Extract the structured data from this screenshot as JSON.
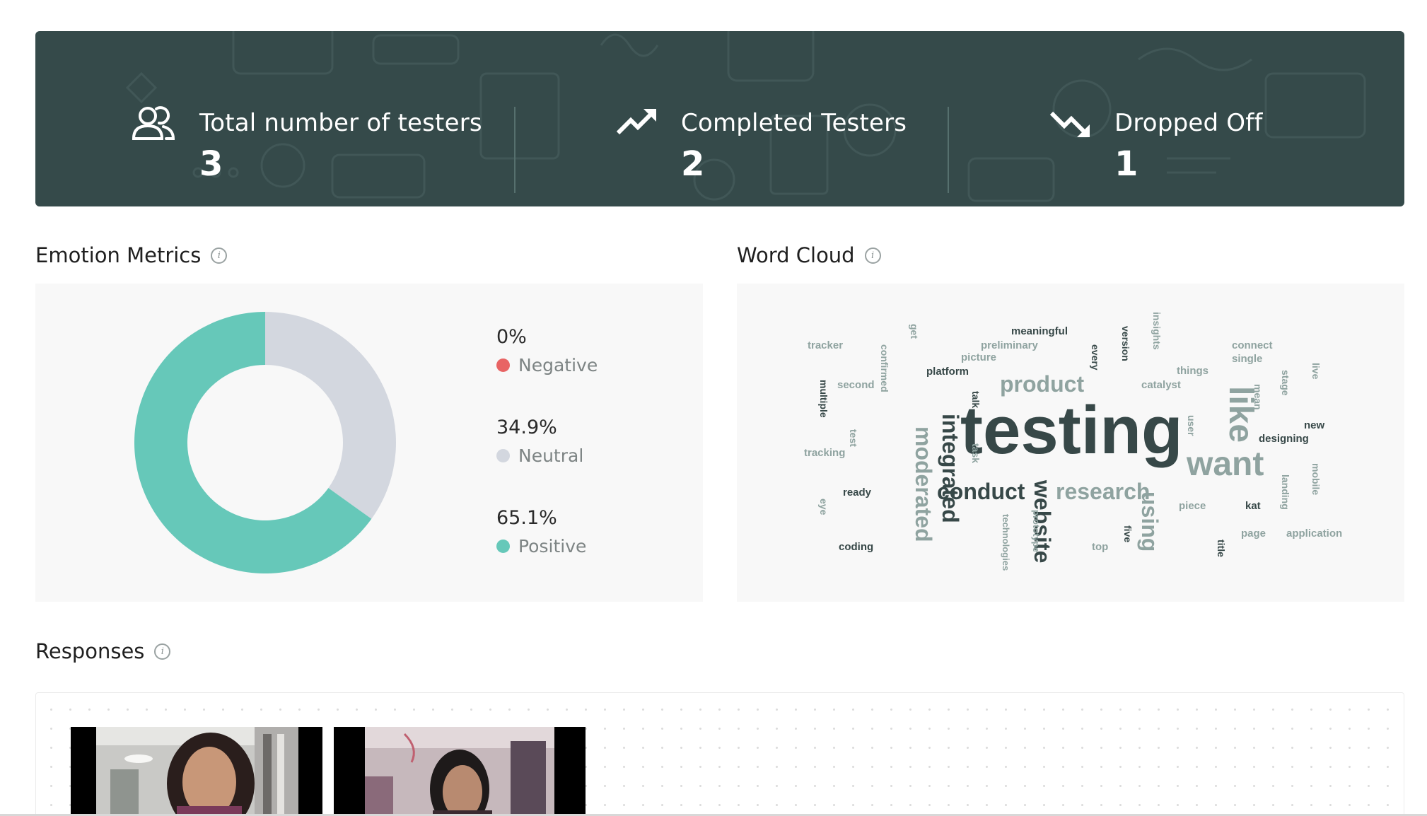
{
  "stats": [
    {
      "label": "Total number of testers",
      "value": "3",
      "icon": "users-icon"
    },
    {
      "label": "Completed Testers",
      "value": "2",
      "icon": "trend-up-icon"
    },
    {
      "label": "Dropped Off",
      "value": "1",
      "icon": "trend-down-icon"
    }
  ],
  "emotion": {
    "title": "Emotion Metrics",
    "items": [
      {
        "percent": "0%",
        "label": "Negative",
        "value": 0,
        "color": "#e86464"
      },
      {
        "percent": "34.9%",
        "label": "Neutral",
        "value": 34.9,
        "color": "#d3d7df"
      },
      {
        "percent": "65.1%",
        "label": "Positive",
        "value": 65.1,
        "color": "#66c8b9"
      }
    ]
  },
  "wordcloud": {
    "title": "Word Cloud",
    "words": [
      "testing",
      "like",
      "want",
      "product",
      "research",
      "conduct",
      "integrated",
      "moderated",
      "website",
      "using",
      "tracker",
      "get",
      "meaningful",
      "preliminary",
      "picture",
      "platform",
      "every",
      "version",
      "insights",
      "connect",
      "single",
      "things",
      "catalyst",
      "stage",
      "live",
      "mean",
      "confirmed",
      "multiple",
      "second",
      "talk",
      "test",
      "tracking",
      "task",
      "user",
      "new",
      "designing",
      "ready",
      "eye",
      "coding",
      "technologies",
      "prototype",
      "top",
      "five",
      "piece",
      "kat",
      "landing",
      "mobile",
      "page",
      "application",
      "title"
    ]
  },
  "responses": {
    "title": "Responses"
  }
}
